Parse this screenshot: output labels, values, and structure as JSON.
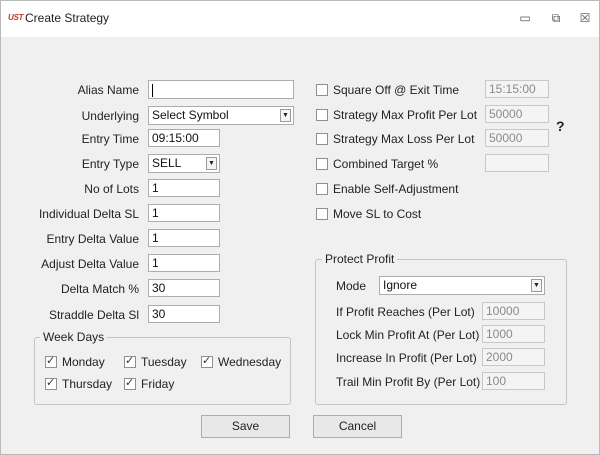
{
  "window": {
    "title": "Create Strategy",
    "app_icon_text": "UST",
    "minimize_glyph": "▭",
    "maximize_glyph": "⧉",
    "close_glyph": "☒"
  },
  "left_form": {
    "alias_name": {
      "label": "Alias Name",
      "value": ""
    },
    "underlying": {
      "label": "Underlying",
      "value": "Select Symbol"
    },
    "entry_time": {
      "label": "Entry Time",
      "value": "09:15:00"
    },
    "entry_type": {
      "label": "Entry Type",
      "value": "SELL"
    },
    "no_of_lots": {
      "label": "No of Lots",
      "value": "1"
    },
    "individual_delta_sl": {
      "label": "Individual Delta SL",
      "value": "1"
    },
    "entry_delta_value": {
      "label": "Entry Delta Value",
      "value": "1"
    },
    "adjust_delta_value": {
      "label": "Adjust Delta Value",
      "value": "1"
    },
    "delta_match": {
      "label": "Delta Match %",
      "value": "30"
    },
    "straddle_delta_sl": {
      "label": "Straddle Delta Sl",
      "value": "30"
    }
  },
  "week_days": {
    "title": "Week Days",
    "days": [
      {
        "label": "Monday",
        "checked": true
      },
      {
        "label": "Tuesday",
        "checked": true
      },
      {
        "label": "Wednesday",
        "checked": true
      },
      {
        "label": "Thursday",
        "checked": true
      },
      {
        "label": "Friday",
        "checked": true
      }
    ]
  },
  "right_options": {
    "square_off": {
      "label": "Square Off @ Exit Time",
      "value": "15:15:00",
      "checked": false
    },
    "max_profit": {
      "label": "Strategy Max Profit Per Lot",
      "value": "50000",
      "checked": false
    },
    "max_loss": {
      "label": "Strategy Max Loss Per Lot",
      "value": "50000",
      "checked": false
    },
    "combined_target": {
      "label": "Combined Target %",
      "value": "",
      "checked": false
    },
    "self_adjustment": {
      "label": "Enable Self-Adjustment",
      "checked": false
    },
    "move_sl": {
      "label": "Move SL to Cost",
      "checked": false
    },
    "help_text": "?"
  },
  "protect_profit": {
    "title": "Protect Profit",
    "mode_label": "Mode",
    "mode_value": "Ignore",
    "profit_reaches": {
      "label": "If Profit Reaches (Per Lot)",
      "value": "10000"
    },
    "lock_min_profit": {
      "label": "Lock Min Profit At (Per Lot)",
      "value": "1000"
    },
    "increase_in_profit": {
      "label": "Increase In Profit (Per Lot)",
      "value": "2000"
    },
    "trail_min_profit": {
      "label": "Trail Min Profit By (Per Lot)",
      "value": "100"
    }
  },
  "buttons": {
    "save": "Save",
    "cancel": "Cancel"
  },
  "colors": {
    "accent_icon": "#c0392b",
    "background": "#f0f0f0"
  }
}
